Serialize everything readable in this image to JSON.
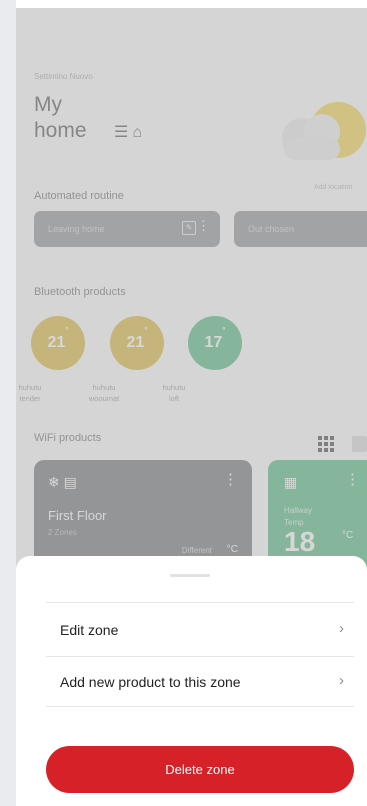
{
  "home": {
    "location": "Settimino Nuovo",
    "title_line1": "My",
    "title_line2": "home",
    "weather_caption": "Add location"
  },
  "automated": {
    "heading": "Automated routine",
    "cards": [
      {
        "label": "Leaving home"
      },
      {
        "label": "Out chosen"
      }
    ]
  },
  "bluetooth": {
    "heading": "Bluetooth products",
    "devices": [
      {
        "temp": "21",
        "unit": "°",
        "caption_l1": "huhutu",
        "caption_l2": "tender",
        "color": "#d1a300"
      },
      {
        "temp": "21",
        "unit": "°",
        "caption_l1": "huhutu",
        "caption_l2": "wooumat",
        "color": "#d1a300"
      },
      {
        "temp": "17",
        "unit": "°",
        "caption_l1": "huhutu",
        "caption_l2": "loft",
        "color": "#1fa55a"
      }
    ]
  },
  "wifi": {
    "heading": "WiFi products",
    "cards": [
      {
        "name": "First Floor",
        "sub": "2 Zones",
        "status": "Different",
        "unit": "°C",
        "color": "#474a4f"
      },
      {
        "name": "Hallway",
        "sub": "Temp",
        "temp": "18",
        "unit": "°C",
        "color": "#1fa55a"
      }
    ]
  },
  "sheet": {
    "items": [
      {
        "label": "Edit zone"
      },
      {
        "label": "Add new product to this zone"
      }
    ],
    "delete_label": "Delete zone"
  },
  "colors": {
    "accent_red": "#d52127",
    "bt_yellow": "#d1a300",
    "green": "#1fa55a"
  }
}
